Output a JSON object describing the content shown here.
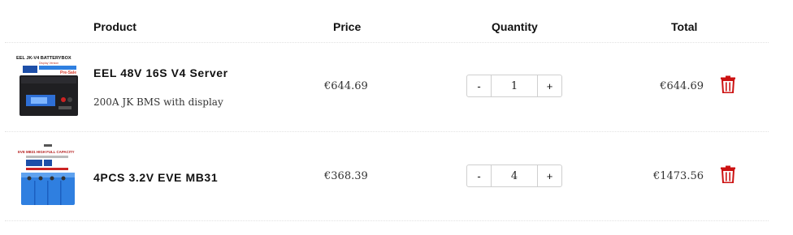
{
  "table": {
    "headers": {
      "product": "Product",
      "price": "Price",
      "quantity": "Quantity",
      "total": "Total"
    },
    "items": [
      {
        "name": "EEL 48V 16S V4 Server",
        "description": "200A JK BMS with display",
        "price": "€644.69",
        "quantity": "1",
        "total": "€644.69",
        "image_text": {
          "title": "EEL JK-V4 BATTERYBOX",
          "subtitle": "Display Version",
          "badge": "Pre-Sale"
        }
      },
      {
        "name": "4PCS 3.2V EVE MB31",
        "description": "",
        "price": "€368.39",
        "quantity": "4",
        "total": "€1473.56",
        "image_text": {
          "title": "EVE MB31 HIGH FULL CAPACITY"
        }
      }
    ]
  },
  "controls": {
    "minus": "-",
    "plus": "+"
  },
  "colors": {
    "trash": "#cc1111",
    "divider": "#e2e2e2",
    "battery_blue": "#2f7fe0"
  },
  "icons": {
    "delete": "trash-icon"
  }
}
